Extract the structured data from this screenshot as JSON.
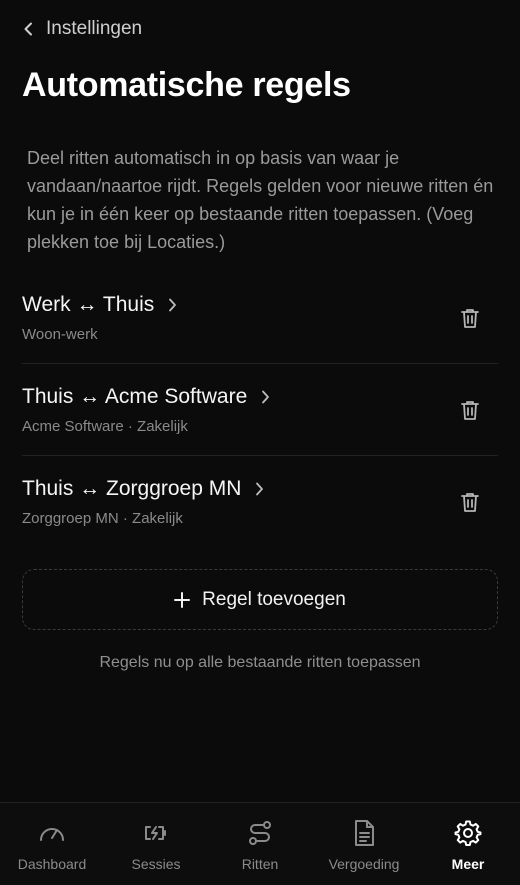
{
  "header": {
    "back_label": "Instellingen",
    "title": "Automatische regels",
    "description": "Deel ritten automatisch in op basis van waar je vandaan/naartoe rijdt. Regels gelden voor nieuwe ritten én kun je in één keer op bestaande ritten toepassen. (Voeg plekken toe bij Locaties.)"
  },
  "rules": [
    {
      "title": "Werk ↔ Thuis",
      "subtitle": "Woon-werk"
    },
    {
      "title": "Thuis ↔ Acme Software",
      "subtitle": "Acme Software · Zakelijk"
    },
    {
      "title": "Thuis ↔ Zorggroep MN",
      "subtitle": "Zorggroep MN · Zakelijk"
    }
  ],
  "actions": {
    "add_label": "Regel toevoegen",
    "apply_label": "Regels nu op alle bestaande ritten toepassen"
  },
  "nav": {
    "items": [
      {
        "label": "Dashboard",
        "icon": "gauge-icon"
      },
      {
        "label": "Sessies",
        "icon": "charging-icon"
      },
      {
        "label": "Ritten",
        "icon": "route-icon"
      },
      {
        "label": "Vergoeding",
        "icon": "document-icon"
      },
      {
        "label": "Meer",
        "icon": "gear-icon"
      }
    ],
    "active": "Meer"
  },
  "colors": {
    "background": "#0b0b0c",
    "text_primary": "#f5f5f5",
    "text_secondary": "#8a8a8a",
    "divider": "#232325"
  }
}
